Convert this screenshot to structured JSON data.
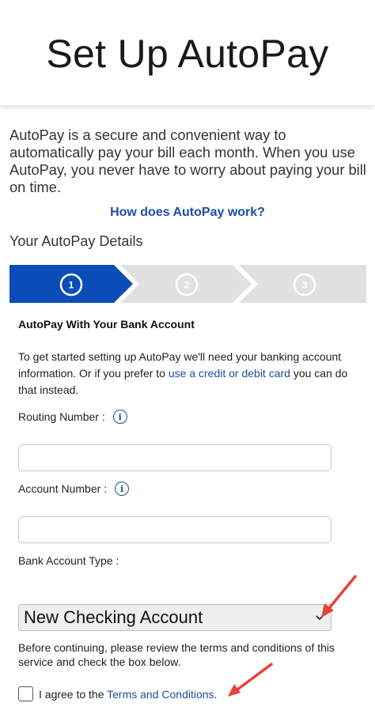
{
  "page": {
    "title": "Set Up AutoPay",
    "intro": "AutoPay is a secure and convenient way to automatically pay your bill each month. When you use AutoPay, you never have to worry about paying your bill on time.",
    "how_link": "How does AutoPay work?",
    "details_title": "Your AutoPay Details"
  },
  "stepper": {
    "steps": [
      {
        "label": "1",
        "state": "active"
      },
      {
        "label": "2",
        "state": "inactive"
      },
      {
        "label": "3",
        "state": "inactive"
      }
    ],
    "active_color": "#0b4db8",
    "inactive_color": "#e1e1e1"
  },
  "bank_form": {
    "title": "AutoPay With Your Bank Account",
    "desc_before": "To get started setting up AutoPay we'll need your banking account information. Or if you prefer to ",
    "desc_link": "use a credit or debit card",
    "desc_after": " you can do that instead.",
    "routing_label": "Routing Number :",
    "routing_value": "",
    "account_label": "Account Number :",
    "account_value": "",
    "type_label": "Bank Account Type :",
    "type_selected": "New Checking Account",
    "info_glyph": "i"
  },
  "terms": {
    "text": "Before continuing, please review the terms and conditions of this service and check the box below.",
    "agree_before": "I agree to the ",
    "agree_link": "Terms and Conditions",
    "agree_after": "."
  },
  "colors": {
    "link": "#1c4fa0",
    "annotation_arrow": "#e8413a"
  }
}
